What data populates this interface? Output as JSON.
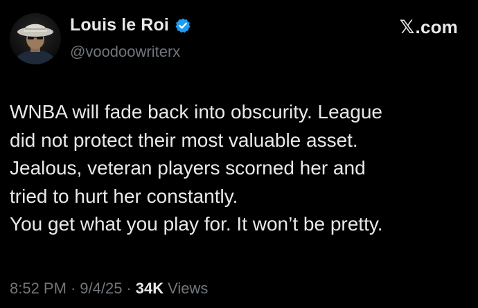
{
  "author": {
    "display_name": "Louis le Roi",
    "handle": "@voodoowriterx",
    "avatar_icon": "profile-photo-man-in-bucket-hat",
    "verified_icon": "verified-badge-icon",
    "verified_color": "#1d9bf0"
  },
  "brand": {
    "glyph": "𝕏",
    "suffix": ".com"
  },
  "tweet": {
    "lines": [
      "WNBA will fade back into obscurity. League",
      "did not protect their most valuable asset.",
      "Jealous, veteran players scorned her and",
      "tried to hurt her constantly.",
      "You get what you play for. It won’t be pretty."
    ]
  },
  "meta": {
    "time": "8:52 PM",
    "date": "9/4/25",
    "separator": "·",
    "views_count": "34K",
    "views_label": "Views"
  },
  "colors": {
    "background": "#000000",
    "primary_text": "#e7e9ea",
    "secondary_text": "#71767b"
  }
}
